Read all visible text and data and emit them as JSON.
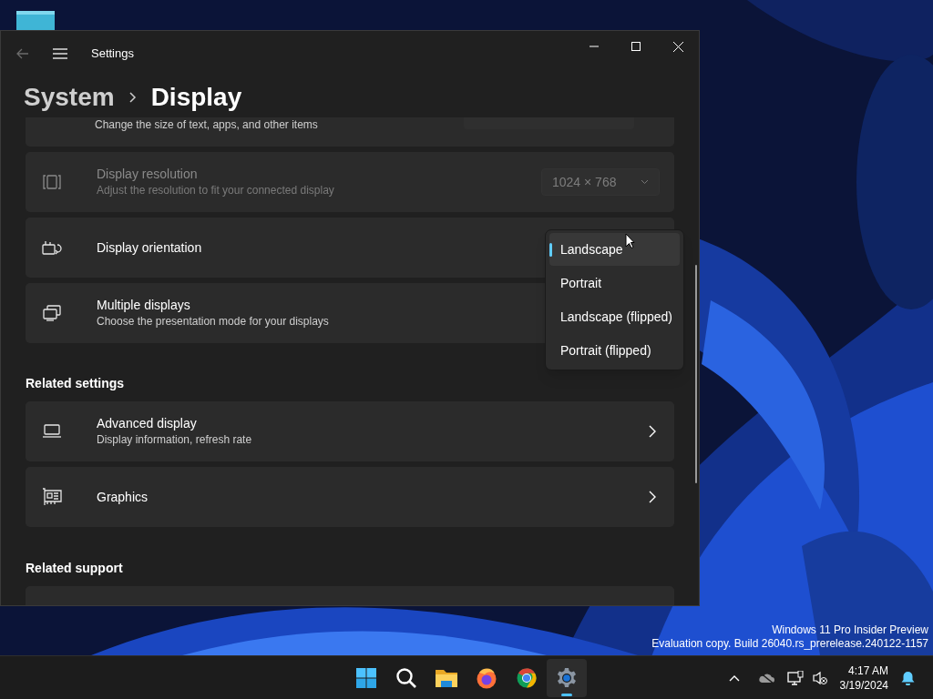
{
  "desktop": {
    "watermark": [
      "Windows 11 Pro Insider Preview",
      "Evaluation copy. Build 26040.rs_prerelease.240122-1157"
    ]
  },
  "window": {
    "title": "Settings",
    "breadcrumb": [
      "System",
      "Display"
    ]
  },
  "settings": [
    {
      "kind": "partial",
      "description": "Change the size of text, apps, and other items"
    },
    {
      "kind": "dropdown",
      "title": "Display resolution",
      "description": "Adjust the resolution to fit your connected display",
      "value": "1024 × 768",
      "disabled": true
    },
    {
      "kind": "open",
      "title": "Display orientation",
      "disabled": false
    },
    {
      "kind": "expander",
      "title": "Multiple displays",
      "description": "Choose the presentation mode for your displays"
    }
  ],
  "orientation_menu": [
    {
      "label": "Landscape",
      "selected": true
    },
    {
      "label": "Portrait",
      "selected": false
    },
    {
      "label": "Landscape (flipped)",
      "selected": false
    },
    {
      "label": "Portrait (flipped)",
      "selected": false
    }
  ],
  "related_settings": {
    "heading": "Related settings",
    "items": [
      {
        "title": "Advanced display",
        "description": "Display information, refresh rate"
      },
      {
        "title": "Graphics"
      }
    ]
  },
  "related_support": {
    "heading": "Related support"
  },
  "taskbar": {
    "apps": [
      {
        "kind": "start",
        "active": false
      },
      {
        "kind": "search",
        "active": false
      },
      {
        "kind": "folder",
        "active": false
      },
      {
        "kind": "fox",
        "active": false
      },
      {
        "kind": "browser",
        "active": false
      },
      {
        "kind": "settings",
        "active": true
      }
    ],
    "time": "4:17 AM",
    "date": "3/19/2024"
  }
}
